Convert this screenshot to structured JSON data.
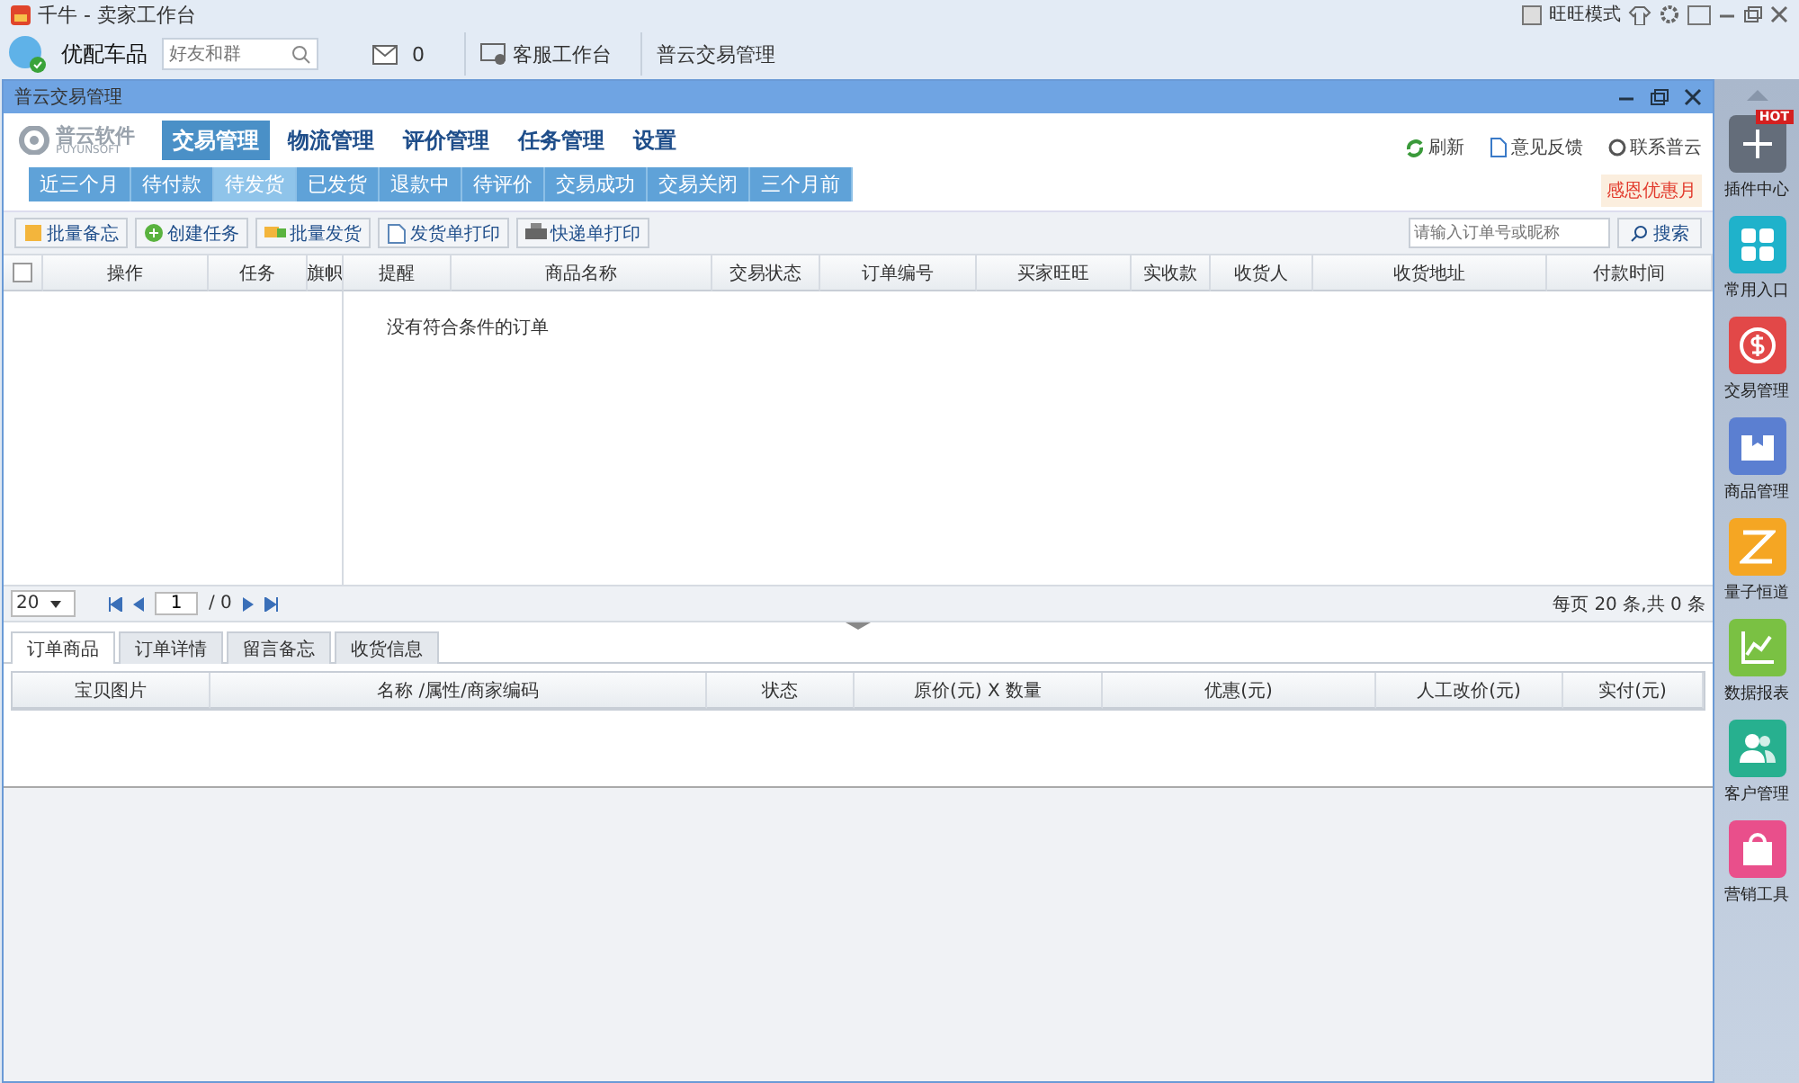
{
  "app_title": "千牛 - 卖家工作台",
  "title_controls": {
    "mode_label": "旺旺模式"
  },
  "account": {
    "name": "优配车品",
    "search_placeholder": "好友和群",
    "message_count": "0"
  },
  "top_tabs": [
    {
      "label": "客服工作台",
      "kind": "icon"
    },
    {
      "label": "普云交易管理",
      "kind": "plain"
    }
  ],
  "window": {
    "title": "普云交易管理"
  },
  "logo": {
    "name": "普云软件",
    "sub": "PUYUNSOFT"
  },
  "nav": [
    {
      "label": "交易管理",
      "selected": true
    },
    {
      "label": "物流管理",
      "selected": false
    },
    {
      "label": "评价管理",
      "selected": false
    },
    {
      "label": "任务管理",
      "selected": false
    },
    {
      "label": "设置",
      "selected": false
    }
  ],
  "header_links": [
    {
      "label": "刷新",
      "kind": "refresh"
    },
    {
      "label": "意见反馈",
      "kind": "doc"
    },
    {
      "label": "联系普云",
      "kind": "contact"
    }
  ],
  "promo": "感恩优惠月",
  "status_tabs": [
    {
      "label": "近三个月",
      "selected": false
    },
    {
      "label": "待付款",
      "selected": false
    },
    {
      "label": "待发货",
      "selected": true
    },
    {
      "label": "已发货",
      "selected": false
    },
    {
      "label": "退款中",
      "selected": false
    },
    {
      "label": "待评价",
      "selected": false
    },
    {
      "label": "交易成功",
      "selected": false
    },
    {
      "label": "交易关闭",
      "selected": false
    },
    {
      "label": "三个月前",
      "selected": false
    }
  ],
  "actions": [
    {
      "label": "批量备忘",
      "kind": "note"
    },
    {
      "label": "创建任务",
      "kind": "add"
    },
    {
      "label": "批量发货",
      "kind": "ship"
    },
    {
      "label": "发货单打印",
      "kind": "doc"
    },
    {
      "label": "快递单打印",
      "kind": "print"
    }
  ],
  "search": {
    "placeholder": "请输入订单号或昵称",
    "button": "搜索"
  },
  "table": {
    "select_all_checked": false,
    "columns": [
      "操作",
      "任务",
      "旗帜",
      "提醒",
      "商品名称",
      "交易状态",
      "订单编号",
      "买家旺旺",
      "实收款",
      "收货人",
      "收货地址",
      "付款时间"
    ],
    "empty_message": "没有符合条件的订单"
  },
  "pager": {
    "page_size": "20",
    "page": "1",
    "total_pages": "/ 0",
    "summary": "每页 20 条,共 0 条"
  },
  "detail_tabs": [
    {
      "label": "订单商品",
      "selected": true
    },
    {
      "label": "订单详情",
      "selected": false
    },
    {
      "label": "留言备忘",
      "selected": false
    },
    {
      "label": "收货信息",
      "selected": false
    }
  ],
  "detail_columns": [
    "宝贝图片",
    "名称 /属性/商家编码",
    "状态",
    "原价(元) X 数量",
    "优惠(元)",
    "人工改价(元)",
    "实付(元)"
  ],
  "sidebar": [
    {
      "label": "插件中心",
      "kind": "plugin",
      "badge": "HOT"
    },
    {
      "label": "常用入口",
      "kind": "grid"
    },
    {
      "label": "交易管理",
      "kind": "money"
    },
    {
      "label": "商品管理",
      "kind": "box"
    },
    {
      "label": "量子恒道",
      "kind": "quantum"
    },
    {
      "label": "数据报表",
      "kind": "chart"
    },
    {
      "label": "客户管理",
      "kind": "people"
    },
    {
      "label": "营销工具",
      "kind": "sale"
    }
  ]
}
